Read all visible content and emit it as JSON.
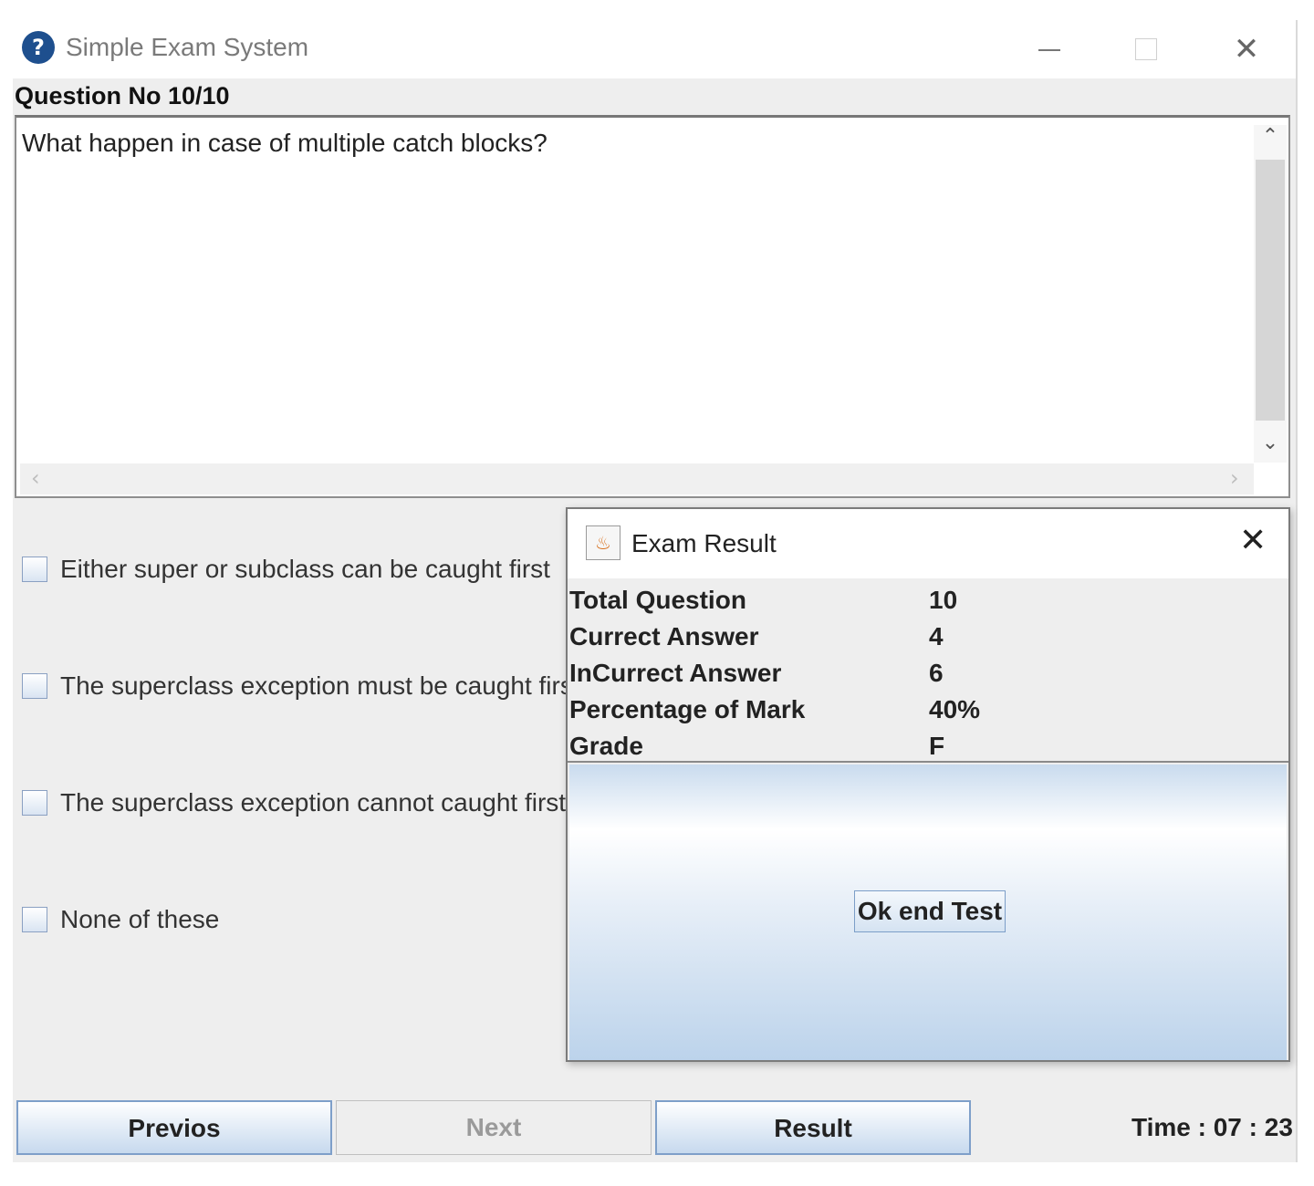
{
  "window": {
    "title": "Simple Exam System",
    "app_icon_glyph": "?",
    "minimize_icon": "minimize-icon",
    "maximize_icon": "maximize-icon",
    "close_glyph": "✕"
  },
  "question": {
    "label": "Question No 10/10",
    "text": "What happen in case of multiple catch blocks?"
  },
  "scroll": {
    "up": "⌃",
    "down": "⌄",
    "left": "‹",
    "right": "›"
  },
  "options": [
    {
      "label": "Either super or subclass can be caught first",
      "checked": false
    },
    {
      "label": "The superclass exception must be caught first",
      "checked": false
    },
    {
      "label": "The superclass exception cannot caught first",
      "checked": false
    },
    {
      "label": "None of these",
      "checked": false
    }
  ],
  "buttons": {
    "previous": "Previos",
    "next": "Next",
    "result": "Result"
  },
  "timer": "Time : 07 : 23",
  "dialog": {
    "title": "Exam Result",
    "icon_glyph": "♨",
    "close_glyph": "✕",
    "rows": [
      {
        "label": "Total Question",
        "value": "10"
      },
      {
        "label": "Currect Answer",
        "value": "4"
      },
      {
        "label": "InCurrect Answer",
        "value": "6"
      },
      {
        "label": "Percentage of Mark",
        "value": "40%"
      },
      {
        "label": "Grade",
        "value": "F"
      }
    ],
    "ok_button": "Ok end Test"
  },
  "colors": {
    "window_bg": "#eeeeee",
    "button_border": "#7e9fc9",
    "app_icon": "#1e4f8e"
  }
}
